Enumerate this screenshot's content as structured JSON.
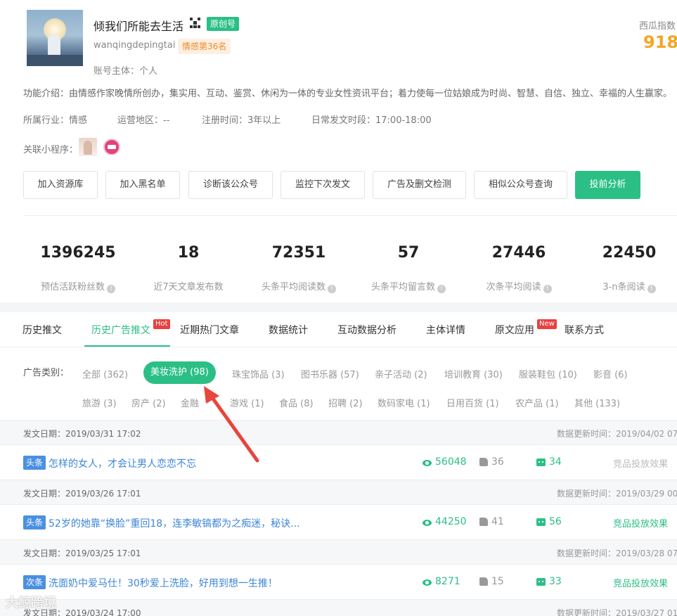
{
  "account": {
    "name": "倾我们所能去生活",
    "original_tag": "原创号",
    "id": "wanqingdepingtai",
    "rank_tag": "情感第36名",
    "owner": "账号主体：个人",
    "xigua_label": "西瓜指数",
    "xigua_value": "918."
  },
  "intro": "功能介绍：由情感作家晚情所创办，集实用、互动、鉴赏、休闲为一体的专业女性资讯平台；着力使每一位姑娘成为时尚、智慧、自信、独立、幸福的人生赢家。",
  "meta": {
    "industry": "所属行业：情感",
    "region": "运营地区：--",
    "registered": "注册时间：3年以上",
    "post_time": "日常发文时段：17:00-18:00"
  },
  "mini_programs_label": "关联小程序：",
  "buttons": [
    "加入资源库",
    "加入黑名单",
    "诊断该公众号",
    "监控下次发文",
    "广告及删文检测",
    "相似公众号查询",
    "投前分析"
  ],
  "stats": [
    {
      "value": "1396245",
      "label": "预估活跃粉丝数"
    },
    {
      "value": "18",
      "label": "近7天文章发布数"
    },
    {
      "value": "72351",
      "label": "头条平均阅读数"
    },
    {
      "value": "57",
      "label": "头条平均留言数"
    },
    {
      "value": "27446",
      "label": "次条平均阅读"
    },
    {
      "value": "22450",
      "label": "3-n条阅读"
    }
  ],
  "info_glyph": "!",
  "tabs": [
    "历史推文",
    "历史广告推文",
    "近期热门文章",
    "数据统计",
    "互动数据分析",
    "主体详情",
    "原文应用",
    "联系方式"
  ],
  "badges": {
    "hot": "Hot",
    "new": "New"
  },
  "category_label": "广告类别：",
  "categories_row1": [
    "全部 (362)",
    "美妆洗护 (98)",
    "珠宝饰品 (3)",
    "图书乐器 (57)",
    "亲子活动 (2)",
    "培训教育 (30)",
    "服装鞋包 (10)",
    "影音 (6)"
  ],
  "categories_row2": [
    "旅游 (3)",
    "房产 (2)",
    "金融",
    "游戏 (1)",
    "食品 (8)",
    "招聘 (2)",
    "数码家电 (1)",
    "日用百货 (1)",
    "农产品 (1)",
    "其他 (133)"
  ],
  "articles": [
    {
      "date": "发文日期：2019/03/31 17:02",
      "updated": "数据更新时间：2019/04/02 07:",
      "tag": "头条",
      "title": "怎样的女人，才会让男人恋恋不忘",
      "views": "56048",
      "likes": "36",
      "comments": "34",
      "effect": "竞品投放效果"
    },
    {
      "date": "发文日期：2019/03/26 17:01",
      "updated": "数据更新时间：2019/03/29 00:",
      "tag": "头条",
      "title": "52岁的她靠“换脸”重回18，连李敏镐都为之痴迷，秘诀...",
      "views": "44250",
      "likes": "41",
      "comments": "56",
      "effect": "竞品投放效果"
    },
    {
      "date": "发文日期：2019/03/25 17:01",
      "updated": "数据更新时间：2019/03/28 07:",
      "tag": "次条",
      "title": "洗面奶中爱马仕！30秒爱上洗脸，好用到想一生推！",
      "views": "8271",
      "likes": "15",
      "comments": "33",
      "effect": "竞品投放效果"
    },
    {
      "date": "发文日期：2019/03/24 17:00",
      "updated": "数据更新时间：2019/03/27 01:"
    }
  ],
  "watermark": "大鲸跨境",
  "colors": {
    "accent": "#2bbf86",
    "link": "#3d86d6",
    "orange": "#f5a623",
    "arrow": "#e8453c"
  }
}
